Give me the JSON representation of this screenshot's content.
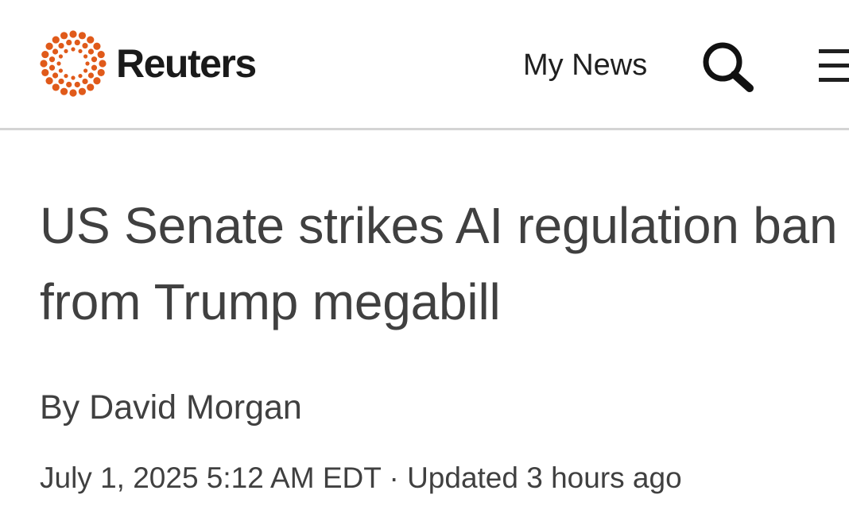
{
  "header": {
    "brand": "Reuters",
    "logo_icon": "reuters-dot-ring-icon",
    "brand_color": "#e05a1a",
    "my_news_label": "My News",
    "search_icon": "search-icon",
    "menu_icon": "hamburger-menu-icon"
  },
  "article": {
    "headline": "US Senate strikes AI regulation ban from Trump megabill",
    "byline_prefix": "By",
    "author": "David Morgan",
    "published": "July 1, 2025 5:12 AM EDT",
    "separator": "·",
    "updated": "Updated 3 hours ago"
  }
}
